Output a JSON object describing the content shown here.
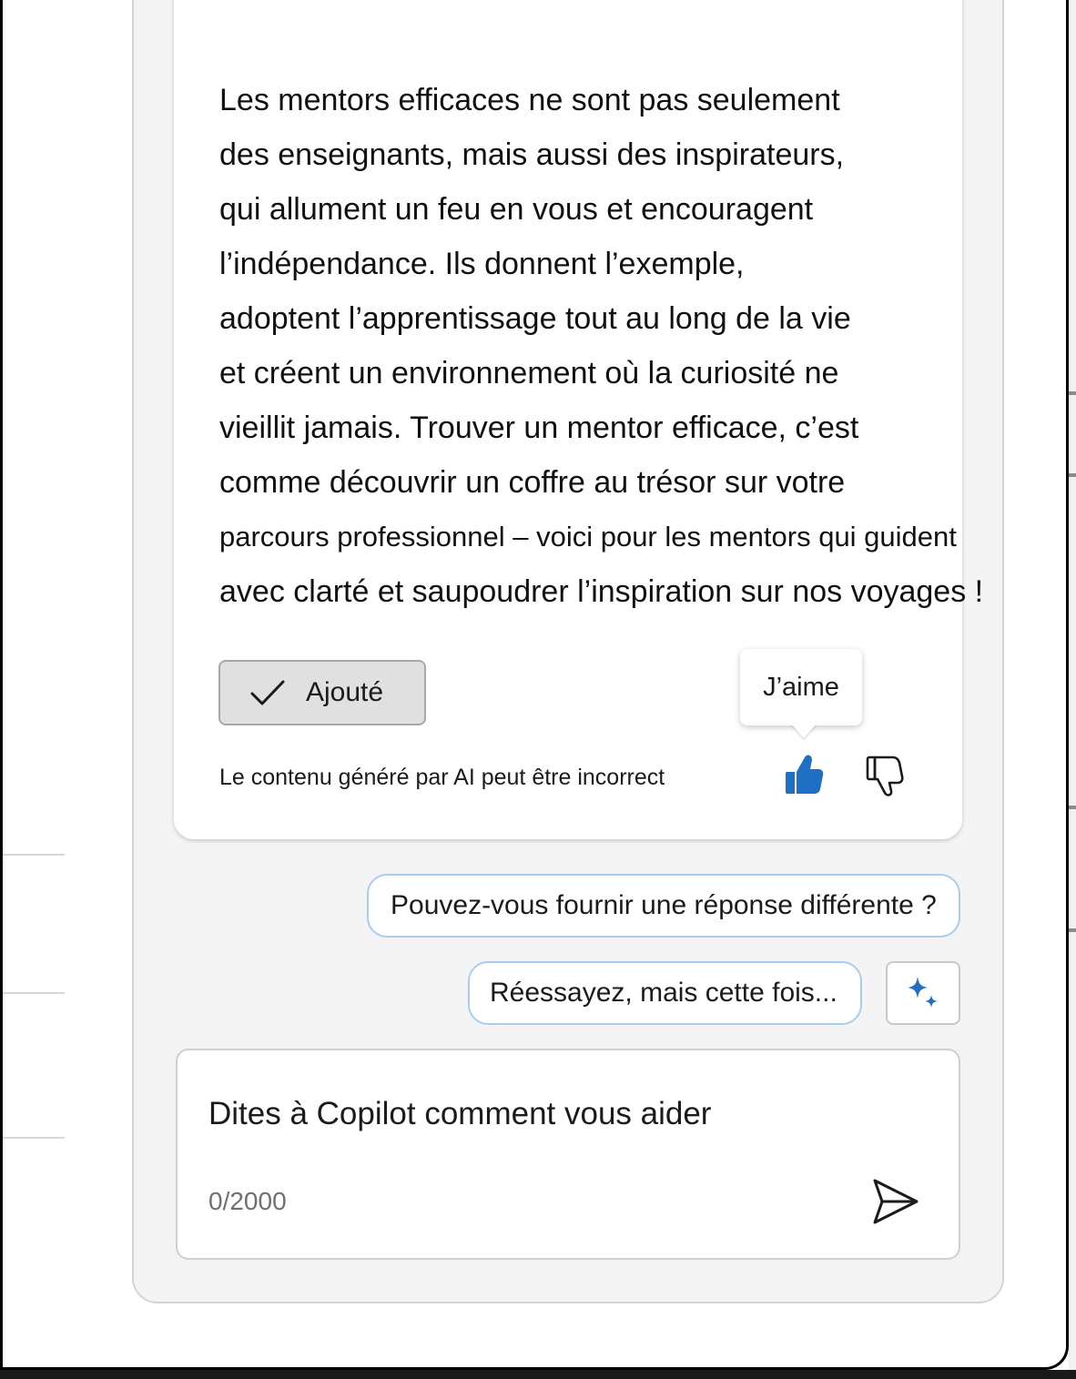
{
  "response": {
    "lines": [
      "Les mentors efficaces ne sont pas seulement",
      "des enseignants, mais aussi des inspirateurs,",
      "qui allument un feu en vous et encouragent",
      "l’indépendance. Ils donnent l’exemple,",
      "adoptent l’apprentissage tout au long de la vie",
      "et créent un environnement où la curiosité ne",
      "vieillit jamais. Trouver un mentor efficace, c’est",
      "comme découvrir un coffre au trésor sur votre",
      "parcours  professionnel – voici pour les mentors qui guident",
      "avec clarté et saupoudrer l’inspiration sur nos voyages !"
    ],
    "added_button_label": "Ajouté",
    "disclaimer": "Le contenu généré par AI peut être incorrect",
    "like_tooltip": "J’aime"
  },
  "suggestions": [
    "Pouvez-vous fournir une réponse différente ?",
    "Réessayez, mais cette fois..."
  ],
  "composer": {
    "placeholder": "Dites à Copilot comment vous aider",
    "counter": "0/2000"
  },
  "icons": {
    "check": "checkmark-icon",
    "like": "thumbs-up-icon",
    "dislike": "thumbs-down-icon",
    "sparkle": "sparkle-icon",
    "send": "send-icon"
  },
  "colors": {
    "accent": "#1f6fc5",
    "suggestion_border": "#a9cdef"
  }
}
